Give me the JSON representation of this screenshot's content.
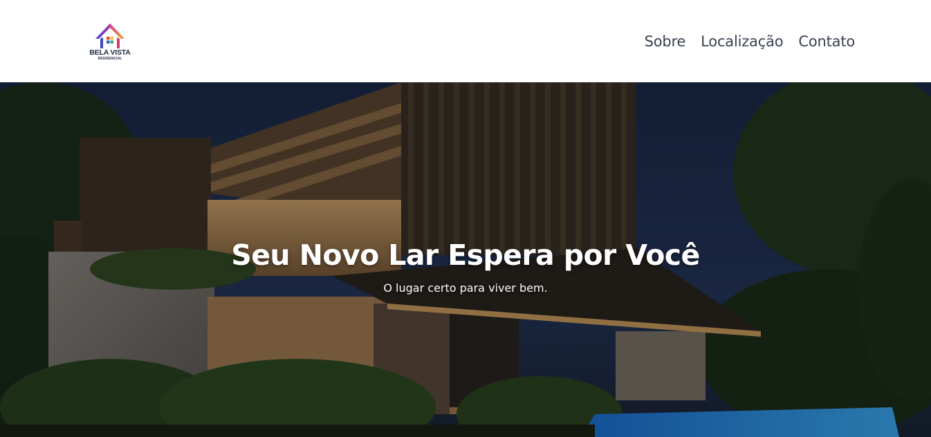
{
  "brand": {
    "name": "BELA VISTA",
    "tagline": "RESIDENCIAL",
    "icon": "house-logo-icon",
    "colors": [
      "#6b3fd8",
      "#e23b8a",
      "#f4a62a",
      "#2f6bd6"
    ]
  },
  "nav": {
    "items": [
      {
        "label": "Sobre"
      },
      {
        "label": "Localização"
      },
      {
        "label": "Contato"
      }
    ]
  },
  "hero": {
    "title": "Seu Novo Lar Espera por Você",
    "subtitle": "O lugar certo para viver bem.",
    "background": "modern-house-night-photo"
  }
}
